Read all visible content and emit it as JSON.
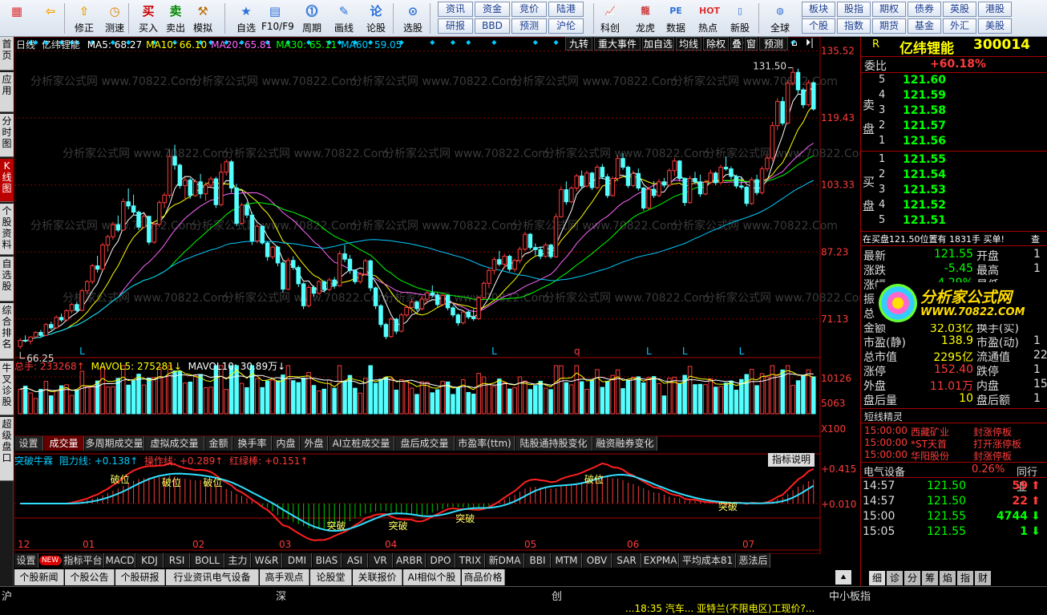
{
  "toolbar": {
    "buttons": [
      {
        "label": "",
        "icon": "grid"
      },
      {
        "label": "",
        "icon": "back"
      },
      {
        "label": "修正",
        "icon": "up"
      },
      {
        "label": "测速",
        "icon": "clock"
      },
      {
        "label": "买入",
        "icon": "buy",
        "glyph": "买"
      },
      {
        "label": "卖出",
        "icon": "sell",
        "glyph": "卖"
      },
      {
        "label": "模拟",
        "icon": "hammer"
      },
      {
        "label": "自选",
        "icon": "star"
      },
      {
        "label": "F10/F9",
        "icon": "f10"
      },
      {
        "label": "周期",
        "icon": "cycle"
      },
      {
        "label": "画线",
        "icon": "pen"
      },
      {
        "label": "论股",
        "icon": "lun",
        "glyph": "论"
      },
      {
        "label": "选股",
        "icon": "select"
      }
    ],
    "links": [
      "资讯",
      "资金",
      "竞价",
      "陆港",
      "研报",
      "BBD",
      "预测",
      "沪伦"
    ],
    "buttons2": [
      {
        "label": "科创",
        "icon": "chart"
      },
      {
        "label": "龙虎",
        "icon": "dragon"
      },
      {
        "label": "数据",
        "icon": "pe",
        "glyph": "PE"
      },
      {
        "label": "热点",
        "icon": "hot"
      },
      {
        "label": "新股",
        "icon": "ipo"
      },
      {
        "label": "全球",
        "icon": "globe"
      }
    ],
    "links2": [
      "板块",
      "股指",
      "期权",
      "债券",
      "英股",
      "港股",
      "个股",
      "指数",
      "期货",
      "基金",
      "外汇",
      "美股"
    ]
  },
  "left_tabs": [
    "首页",
    "应用",
    "分时图",
    "K线图",
    "个股资料",
    "自选股",
    "综合排名",
    "牛叉诊股",
    "超级盘口"
  ],
  "kline": {
    "period": "日线",
    "name": "亿纬锂能",
    "ma": [
      {
        "label": "MA5: 68.27",
        "color": "#ffffff"
      },
      {
        "label": "MA10: 66.10",
        "color": "#ffff00"
      },
      {
        "label": "MA20: 65.81",
        "color": "#ff66ff"
      },
      {
        "label": "MA30: 65.11",
        "color": "#00ff00"
      },
      {
        "label": "MA60: 59.05",
        "color": "#00ccff"
      }
    ],
    "buttons": [
      "九转",
      "重大事件",
      "加自选",
      "均线",
      "除权",
      "叠",
      "窗",
      "预测"
    ],
    "price_ticks": [
      "135.52",
      "119.43",
      "103.33",
      "87.23",
      "71.13"
    ],
    "high_label": "131.50",
    "low_label": "66.25",
    "markers": [
      "L",
      "L",
      "q",
      "L",
      "L",
      "L"
    ]
  },
  "volume": {
    "total": "总手: 233268↑",
    "mavol5": "MAVOL5: 275281↓",
    "mavol10": "MAVOL10: 30.89万↓",
    "ticks": [
      "10126",
      "5063",
      "X100"
    ]
  },
  "indicator_tabs": [
    "设置",
    "成交量",
    "多周期成交量",
    "虚拟成交量",
    "金额",
    "换手率",
    "内盘",
    "外盘",
    "AI立桩成交量",
    "盘后成交量",
    "市盈率(ttm)",
    "陆股通持股变化",
    "融资融券变化"
  ],
  "indicator": {
    "name": "突破牛霖",
    "r1": "阻力线: +0.138↑",
    "r2": "操作线: +0.289↑",
    "r3": "红绿棒: +0.151↑",
    "help": "指标说明",
    "ticks": [
      "+0.415",
      "+0.010"
    ],
    "signals": [
      "破位",
      "破位",
      "破位",
      "突破",
      "突破",
      "突破",
      "破位",
      "突破"
    ]
  },
  "months": [
    "12",
    "01",
    "02",
    "03",
    "04",
    "05",
    "06",
    "07"
  ],
  "bottom_tabs": [
    "设置",
    "NEW",
    "指标平台",
    "MACD",
    "KDJ",
    "RSI",
    "BOLL",
    "主力",
    "W&R",
    "DMI",
    "BIAS",
    "ASI",
    "VR",
    "ARBR",
    "DPO",
    "TRIX",
    "新DMA",
    "BBI",
    "MTM",
    "OBV",
    "SAR",
    "EXPMA",
    "平均成本81",
    "恶法后"
  ],
  "news_tabs": [
    "个股新闻",
    "个股公告",
    "个股研报",
    "行业资讯电气设备",
    "高手观点",
    "论股堂",
    "关联报价",
    "AI相似个股",
    "商品价格"
  ],
  "right": {
    "title": "亿纬锂能",
    "code": "300014",
    "r": "R",
    "weibi_label": "委比",
    "weibi": "+60.18%",
    "sell": [
      {
        "n": "5",
        "p": "121.60"
      },
      {
        "n": "4",
        "p": "121.59"
      },
      {
        "n": "3",
        "p": "121.58"
      },
      {
        "n": "2",
        "p": "121.57"
      },
      {
        "n": "1",
        "p": "121.56"
      }
    ],
    "buy": [
      {
        "n": "1",
        "p": "121.55"
      },
      {
        "n": "2",
        "p": "121.54"
      },
      {
        "n": "3",
        "p": "121.53"
      },
      {
        "n": "4",
        "p": "121.52"
      },
      {
        "n": "5",
        "p": "121.51"
      }
    ],
    "sell_label": "卖盘",
    "buy_label": "买盘",
    "note": "在买盘121.50位置有 1831手 买单!",
    "note_extra": "查",
    "quotes": [
      {
        "l": "最新",
        "v": "121.55",
        "l2": "开盘",
        "v2": "1"
      },
      {
        "l": "涨跌",
        "v": "-5.45",
        "l2": "最高",
        "v2": "1"
      },
      {
        "l": "涨幅",
        "v": "-4.29%",
        "l2": "最低",
        "v2": ""
      },
      {
        "l": "振",
        "v": "",
        "l2": "",
        "v2": ""
      },
      {
        "l": "总",
        "v": "",
        "l2": "",
        "v2": "1"
      },
      {
        "l": "金额",
        "v": "32.03亿",
        "l2": "换手(实)",
        "v2": ""
      },
      {
        "l": "市盈(静)",
        "v": "138.9",
        "l2": "市盈(动)",
        "v2": "1"
      },
      {
        "l": "总市值",
        "v": "2295亿",
        "l2": "流通值",
        "v2": "22"
      },
      {
        "l": "涨停",
        "v": "152.40",
        "l2": "跌停",
        "v2": "1"
      },
      {
        "l": "外盘",
        "v": "11.01万",
        "l2": "内盘",
        "v2": "15."
      },
      {
        "l": "盘后量",
        "v": "10",
        "l2": "盘后额",
        "v2": "1"
      }
    ],
    "logo_cn": "分析家公式网",
    "logo_url": "WWW.70822.COM",
    "short_title": "短线精灵",
    "short": [
      {
        "t": "15:00:00",
        "s": "西藏矿业",
        "e": "封涨停板"
      },
      {
        "t": "15:00:00",
        "s": "*ST天首",
        "e": "打开涨停板"
      },
      {
        "t": "15:00:00",
        "s": "华阳股份",
        "e": "封涨停板"
      }
    ],
    "industry": "电气设备",
    "industry_pct": "0.26%",
    "industry_extra": "同行业",
    "ticks": [
      {
        "t": "14:57",
        "p": "121.50",
        "v": "59",
        "d": "up"
      },
      {
        "t": "14:57",
        "p": "121.50",
        "v": "22",
        "d": "up"
      },
      {
        "t": "15:00",
        "p": "121.55",
        "v": "4744",
        "d": "down"
      },
      {
        "t": "15:05",
        "p": "121.55",
        "v": "1",
        "d": "down"
      }
    ],
    "bottom_tabs": [
      "细",
      "诊",
      "分",
      "筹",
      "焰",
      "指",
      "财"
    ]
  },
  "status": {
    "items": [
      "沪",
      "深",
      "创",
      "中小板指"
    ],
    "ticker": "...18:35 汽车... 亚特兰(不限电区)工现价?..."
  },
  "watermark": "分析家公式网 www.70822.Com",
  "chart_data": {
    "type": "candlestick",
    "price_range": [
      63,
      137
    ],
    "candles": [
      [
        64.5,
        66.5,
        64,
        66
      ],
      [
        66,
        67.2,
        65.5,
        65.8
      ],
      [
        65.8,
        67,
        65,
        66.8
      ],
      [
        66.8,
        68.2,
        66.5,
        67.9
      ],
      [
        67.9,
        68.5,
        66.8,
        67.2
      ],
      [
        67.2,
        70.2,
        67,
        69.8
      ],
      [
        69.8,
        70.5,
        68.5,
        69
      ],
      [
        69,
        72,
        68.8,
        71.5
      ],
      [
        71.5,
        72.4,
        70.4,
        70.9
      ],
      [
        70.9,
        73.5,
        70.5,
        73.1
      ],
      [
        73.1,
        75,
        72.5,
        74.6
      ],
      [
        74.6,
        75.2,
        72.8,
        73.2
      ],
      [
        73.2,
        78.4,
        73,
        77.9
      ],
      [
        77.9,
        80.5,
        77.2,
        80.1
      ],
      [
        80.1,
        84.4,
        79.5,
        83.9
      ],
      [
        83.9,
        86.3,
        82.3,
        83.1
      ],
      [
        83.1,
        89.5,
        82.8,
        88.9
      ],
      [
        88.9,
        91.4,
        87.4,
        90.9
      ],
      [
        90.9,
        94.5,
        90.2,
        93.8
      ],
      [
        93.8,
        96,
        92,
        92.5
      ],
      [
        92.5,
        100.1,
        92.3,
        99.3
      ],
      [
        99.3,
        102.5,
        97.5,
        98.3
      ],
      [
        98.3,
        101,
        96,
        96.8
      ],
      [
        96.8,
        97.2,
        92.5,
        93.2
      ],
      [
        93.2,
        96.5,
        93,
        95.8
      ],
      [
        95.8,
        95.9,
        89,
        89.6
      ],
      [
        89.6,
        94.3,
        89.2,
        93.9
      ],
      [
        93.9,
        99.6,
        93.2,
        99.1
      ],
      [
        99.1,
        101.5,
        97.8,
        100.9
      ],
      [
        100.9,
        112,
        100.2,
        110.2
      ],
      [
        110.2,
        113,
        107,
        108.1
      ],
      [
        108.1,
        108.5,
        102.5,
        103.2
      ],
      [
        103.2,
        105.2,
        99.8,
        104.5
      ],
      [
        104.5,
        105,
        100,
        100.8
      ],
      [
        100.8,
        104.7,
        100.4,
        104.1
      ],
      [
        104.1,
        106,
        100.1,
        101.2
      ],
      [
        101.2,
        104,
        99.5,
        103.3
      ],
      [
        103.3,
        105.4,
        102.5,
        104.8
      ],
      [
        104.8,
        105.3,
        97.8,
        98.6
      ],
      [
        98.6,
        108.5,
        98.2,
        106.4
      ],
      [
        106.4,
        109.5,
        105.6,
        108.9
      ],
      [
        108.9,
        109.4,
        101.5,
        102.6
      ],
      [
        102.6,
        103.6,
        93.5,
        94.1
      ],
      [
        94.1,
        99,
        93.8,
        98.5
      ],
      [
        98.5,
        99.2,
        95.4,
        96.1
      ],
      [
        96.1,
        96.8,
        88.9,
        89.9
      ],
      [
        89.9,
        93.9,
        89.3,
        93.4
      ],
      [
        93.4,
        93.5,
        89,
        89.4
      ],
      [
        89.4,
        89.8,
        85.1,
        86.1
      ],
      [
        86.1,
        88.7,
        85.5,
        88.4
      ],
      [
        88.4,
        88.7,
        83.8,
        84.6
      ],
      [
        84.6,
        85.1,
        77.5,
        78.3
      ],
      [
        78.3,
        85.9,
        78,
        85.2
      ],
      [
        85.2,
        86.2,
        82.9,
        83.5
      ],
      [
        83.5,
        84,
        78.8,
        79.6
      ],
      [
        79.6,
        79.9,
        73.5,
        74.3
      ],
      [
        74.3,
        79.3,
        73.9,
        78.7
      ],
      [
        78.7,
        79.2,
        76.5,
        77.3
      ],
      [
        77.3,
        80.5,
        76.9,
        80.1
      ],
      [
        80.1,
        80.4,
        77.5,
        78.2
      ],
      [
        78.2,
        81,
        77.8,
        80.5
      ],
      [
        80.5,
        81.2,
        78.4,
        79.1
      ],
      [
        79.1,
        87.5,
        78.9,
        86.8
      ],
      [
        86.8,
        88.9,
        84.8,
        85.5
      ],
      [
        85.5,
        86.5,
        82,
        82.8
      ],
      [
        82.8,
        83.1,
        79.5,
        80.1
      ],
      [
        80.1,
        82.4,
        79.6,
        81.9
      ],
      [
        81.9,
        85.6,
        81.5,
        85.1
      ],
      [
        85.1,
        85.4,
        77.8,
        78.6
      ],
      [
        78.6,
        78.9,
        73.5,
        74.3
      ],
      [
        74.3,
        74.7,
        69.1,
        69.8
      ],
      [
        69.8,
        70.2,
        66.3,
        66.9
      ],
      [
        66.9,
        71.5,
        66.6,
        71.1
      ],
      [
        71.1,
        71.4,
        67.5,
        68.2
      ],
      [
        68.2,
        72.6,
        67.9,
        72.1
      ],
      [
        72.1,
        74.5,
        71.5,
        73.9
      ],
      [
        73.9,
        75.9,
        72.5,
        75.2
      ],
      [
        75.2,
        75.6,
        73,
        73.6
      ],
      [
        73.6,
        76.6,
        73.2,
        75.9
      ],
      [
        75.9,
        77.9,
        74.8,
        77.4
      ],
      [
        77.4,
        79.2,
        76.3,
        76.9
      ],
      [
        76.9,
        77.3,
        74.1,
        74.6
      ],
      [
        74.6,
        77.2,
        74.2,
        76.8
      ],
      [
        76.8,
        77.1,
        73.2,
        73.8
      ],
      [
        73.8,
        74.3,
        71.5,
        72.1
      ],
      [
        72.1,
        72.5,
        69.5,
        70.2
      ],
      [
        70.2,
        73.1,
        69.8,
        72.8
      ],
      [
        72.8,
        73.2,
        71.1,
        71.6
      ],
      [
        71.6,
        73.5,
        70.7,
        71.2
      ],
      [
        71.2,
        76.6,
        70.9,
        76.2
      ],
      [
        76.2,
        80.2,
        75.9,
        79.7
      ],
      [
        79.7,
        83.4,
        78.5,
        82.8
      ],
      [
        82.8,
        86,
        81.8,
        85.4
      ],
      [
        85.4,
        87.5,
        83.8,
        84.3
      ],
      [
        84.3,
        86.8,
        83.3,
        86.2
      ],
      [
        86.2,
        86.6,
        82.5,
        83.1
      ],
      [
        83.1,
        85.6,
        82.4,
        85.2
      ],
      [
        85.2,
        88.5,
        84.5,
        87.9
      ],
      [
        87.9,
        92.1,
        87.4,
        91.5
      ],
      [
        91.5,
        91.8,
        87.8,
        88.3
      ],
      [
        88.3,
        89.3,
        86.4,
        87.8
      ],
      [
        87.8,
        88.6,
        85.5,
        86.2
      ],
      [
        86.2,
        89.5,
        85.8,
        88.9
      ],
      [
        88.9,
        89.2,
        85.6,
        86.1
      ],
      [
        86.1,
        96.5,
        85.8,
        95.7
      ],
      [
        95.7,
        103,
        95.5,
        102.2
      ],
      [
        102.2,
        104.2,
        98.6,
        99.3
      ],
      [
        99.3,
        103,
        98.9,
        102.6
      ],
      [
        102.6,
        106,
        101.8,
        105.5
      ],
      [
        105.5,
        106.8,
        102.5,
        103.1
      ],
      [
        103.1,
        106.8,
        102.7,
        106.2
      ],
      [
        106.2,
        106.5,
        102.1,
        102.7
      ],
      [
        102.7,
        108.2,
        102.3,
        107.6
      ],
      [
        107.6,
        108.4,
        104.7,
        105.3
      ],
      [
        105.3,
        106,
        100.2,
        100.8
      ],
      [
        100.8,
        105.4,
        100.5,
        104.9
      ],
      [
        104.9,
        110.5,
        104.2,
        109.7
      ],
      [
        109.7,
        111,
        107,
        107.6
      ],
      [
        107.6,
        108,
        102.6,
        103.2
      ],
      [
        103.2,
        106.8,
        102.8,
        106.1
      ],
      [
        106.1,
        107.3,
        102,
        102.6
      ],
      [
        102.6,
        102.9,
        97.2,
        97.8
      ],
      [
        97.8,
        102.9,
        97.5,
        102.3
      ],
      [
        102.3,
        104.3,
        100.2,
        100.8
      ],
      [
        100.8,
        104.8,
        100.4,
        104.1
      ],
      [
        104.1,
        105,
        102.7,
        103.3
      ],
      [
        103.3,
        107.3,
        102.9,
        106.8
      ],
      [
        106.8,
        109.8,
        105.5,
        109.1
      ],
      [
        109.1,
        109.3,
        104.2,
        104.9
      ],
      [
        104.9,
        105.2,
        98.3,
        99.1
      ],
      [
        99.1,
        105.6,
        98.8,
        104.9
      ],
      [
        104.9,
        106.5,
        103.4,
        104.1
      ],
      [
        104.1,
        105.8,
        100.5,
        101.2
      ],
      [
        101.2,
        104.6,
        100.8,
        104
      ],
      [
        104,
        107,
        103.5,
        106.2
      ],
      [
        106.2,
        106.6,
        103.3,
        103.9
      ],
      [
        103.9,
        108.2,
        103.5,
        107.6
      ],
      [
        107.6,
        110.2,
        106.8,
        107.2
      ],
      [
        107.2,
        107.8,
        104.6,
        105.4
      ],
      [
        105.4,
        105.8,
        102.5,
        103.1
      ],
      [
        103.1,
        105.4,
        102.2,
        102.8
      ],
      [
        102.8,
        103.1,
        98.2,
        98.9
      ],
      [
        98.9,
        105.2,
        98.5,
        104.6
      ],
      [
        104.6,
        105.8,
        100.9,
        101.5
      ],
      [
        101.5,
        107.8,
        101,
        107.2
      ],
      [
        107.2,
        110.5,
        106.5,
        109.8
      ],
      [
        109.8,
        118.5,
        109,
        117.6
      ],
      [
        117.6,
        124.2,
        116.5,
        123.4
      ],
      [
        123.4,
        124.5,
        117.6,
        118.2
      ],
      [
        118.2,
        128.6,
        117.8,
        127.8
      ],
      [
        127.8,
        131.5,
        127.2,
        130.4
      ],
      [
        130.4,
        131.3,
        125.4,
        126.2
      ],
      [
        126.2,
        126.7,
        121.8,
        122.6
      ],
      [
        122.6,
        128.6,
        122.2,
        127.9
      ],
      [
        127.9,
        128.2,
        121.2,
        121.6
      ]
    ]
  }
}
